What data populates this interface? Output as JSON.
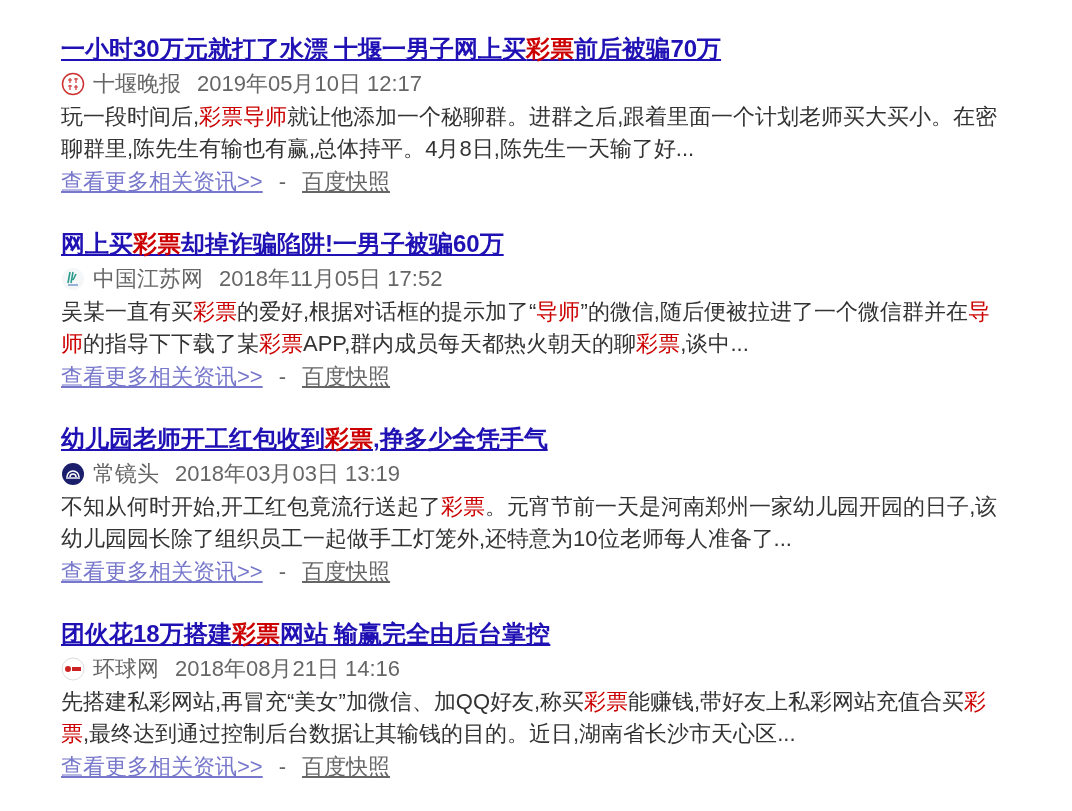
{
  "results": [
    {
      "title": "一小时30万元就打了水漂 十堰一男子网上买**彩票**前后被骗70万",
      "logo": {
        "kind": "seal"
      },
      "source": "十堰晚报",
      "date": "2019年05月10日 12:17",
      "snippet": "玩一段时间后,**彩票导师**就让他添加一个秘聊群。进群之后,跟着里面一个计划老师买大买小。在密聊群里,陈先生有输也有赢,总体持平。4月8日,陈先生一天输了好...",
      "more_link": "查看更多相关资讯>>",
      "separator": "-",
      "cache_link": "百度快照"
    },
    {
      "title": "网上买**彩票**却掉诈骗陷阱!一男子被骗60万",
      "logo": {
        "kind": "strokes"
      },
      "source": "中国江苏网",
      "date": "2018年11月05日 17:52",
      "snippet": "吴某一直有买**彩票**的爱好,根据对话框的提示加了“**导师**”的微信,随后便被拉进了一个微信群并在**导师**的指导下下载了某**彩票**APP,群内成员每天都热火朝天的聊**彩票**,谈中...",
      "more_link": "查看更多相关资讯>>",
      "separator": "-",
      "cache_link": "百度快照"
    },
    {
      "title": "幼儿园老师开工红包收到**彩票**,挣多少全凭手气",
      "logo": {
        "kind": "swirl"
      },
      "source": "常镜头",
      "date": "2018年03月03日 13:19",
      "snippet": "不知从何时开始,开工红包竟流行送起了**彩票**。元宵节前一天是河南郑州一家幼儿园开园的日子,该幼儿园园长除了组织员工一起做手工灯笼外,还特意为10位老师每人准备了...",
      "more_link": "查看更多相关资讯>>",
      "separator": "-",
      "cache_link": "百度快照"
    },
    {
      "title": "团伙花18万搭建**彩票**网站 输赢完全由后台掌控",
      "logo": {
        "kind": "dot"
      },
      "source": "环球网",
      "date": "2018年08月21日 14:16",
      "snippet": "先搭建私彩网站,再冒充“美女”加微信、加QQ好友,称买**彩票**能赚钱,带好友上私彩网站充值合买**彩票**,最终达到通过控制后台数据让其输钱的目的。近日,湖南省长沙市天心区...",
      "more_link": "查看更多相关资讯>>",
      "separator": "-",
      "cache_link": "百度快照"
    }
  ]
}
